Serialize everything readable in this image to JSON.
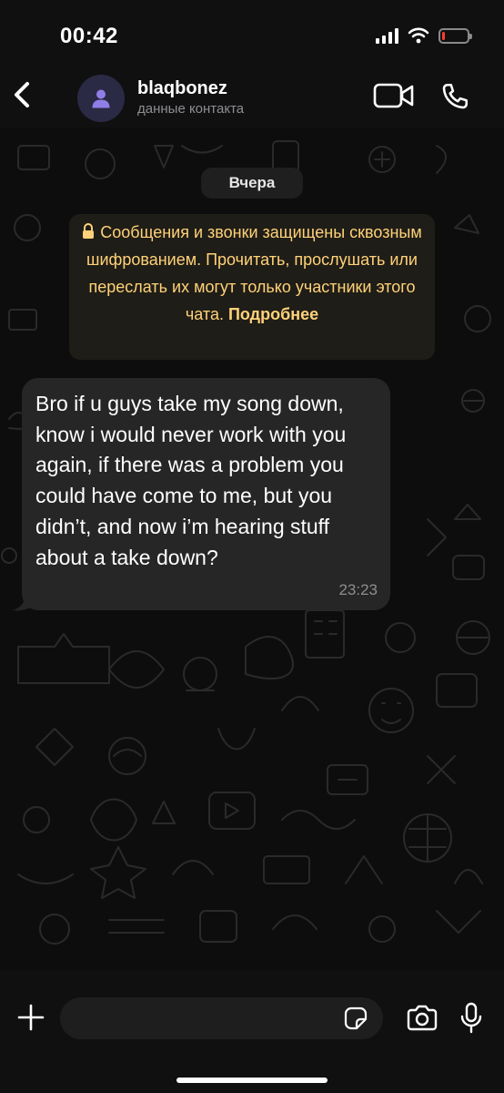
{
  "status_bar": {
    "time": "00:42",
    "battery_level": 0.12,
    "battery_color": "#ff3b30"
  },
  "header": {
    "contact_name": "blaqbonez",
    "contact_subtitle": "данные контакта",
    "avatar_color": "#2b2a45",
    "icons": [
      "back-chevron-icon",
      "person-icon",
      "video-camera-icon",
      "phone-icon"
    ]
  },
  "chat": {
    "date_label": "Вчера",
    "encryption_notice": {
      "text": "Сообщения и звонки защищены сквозным шифрованием. Прочитать, прослушать или переслать их могут только участники этого чата.",
      "link": "Подробнее",
      "color": "#ffd279",
      "icon": "lock-icon"
    },
    "messages": [
      {
        "text": "Bro if u guys take my song down, know i would never work with you again, if there was a problem you could have come to me, but you didn’t, and now i’m hearing stuff about a take down?",
        "time": "23:23",
        "direction": "incoming"
      }
    ]
  },
  "input_bar": {
    "placeholder": "",
    "icons": [
      "plus-icon",
      "sticker-icon",
      "camera-icon",
      "microphone-icon"
    ]
  }
}
